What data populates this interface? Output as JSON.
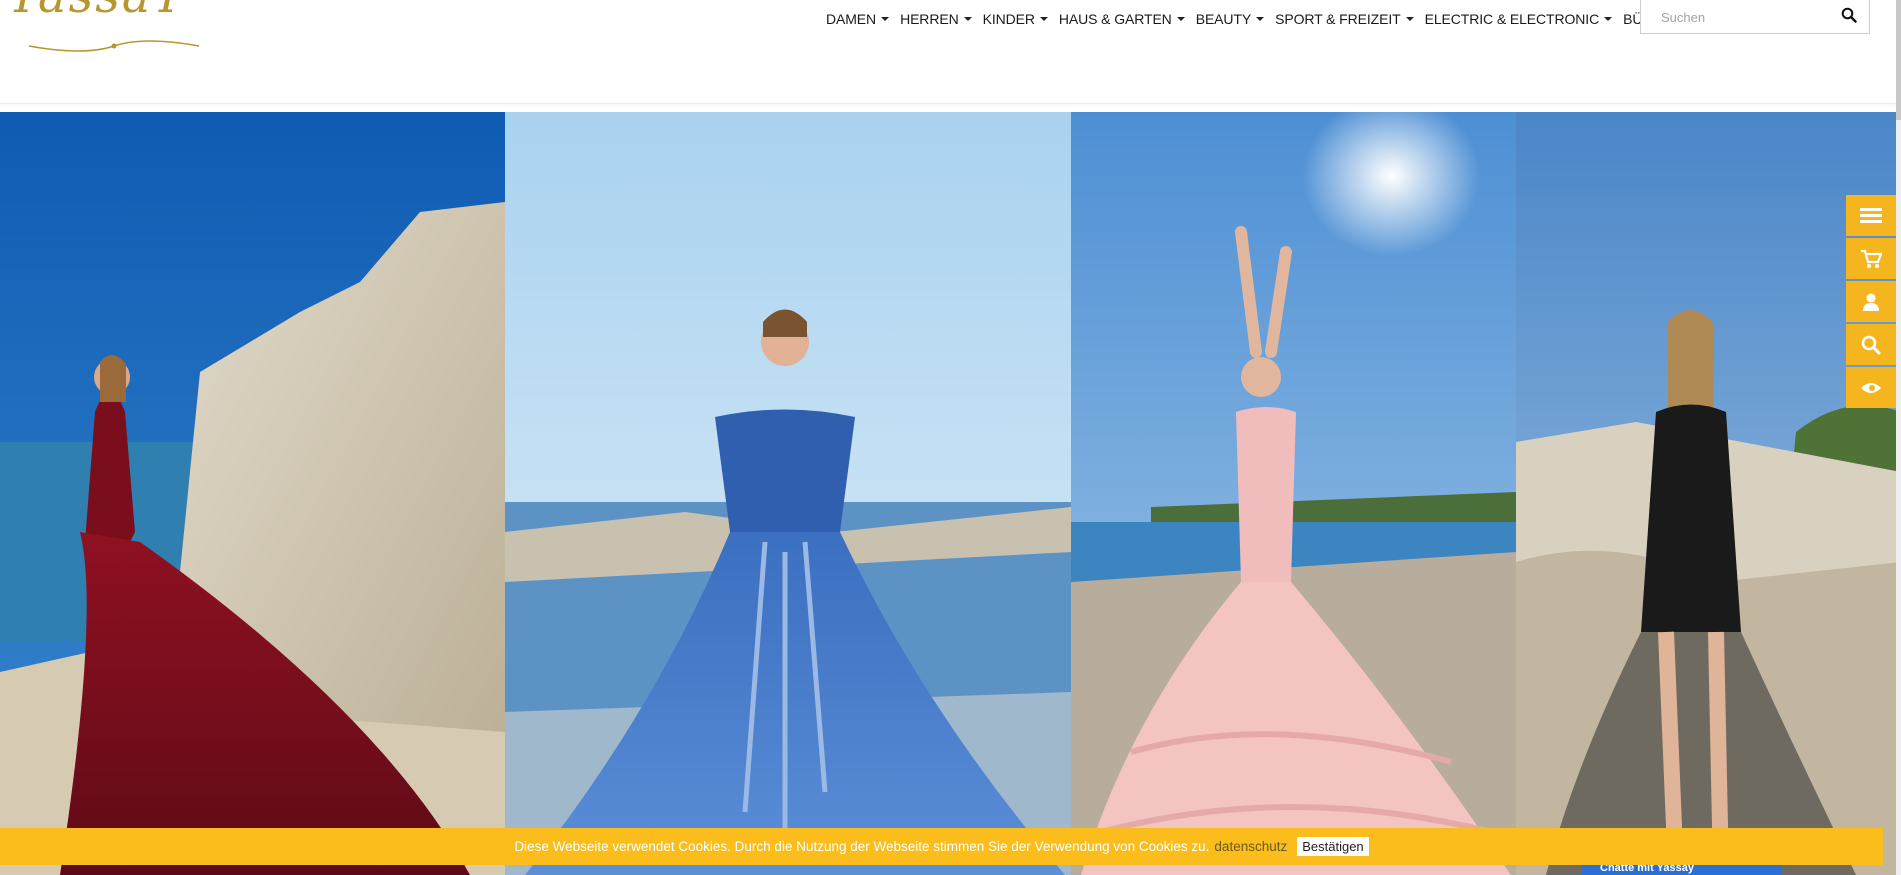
{
  "header": {
    "logo_text": "YassaY",
    "nav": [
      {
        "label": "DAMEN"
      },
      {
        "label": "HERREN"
      },
      {
        "label": "KINDER"
      },
      {
        "label": "HAUS & GARTEN"
      },
      {
        "label": "BEAUTY"
      },
      {
        "label": "SPORT & FREIZEIT"
      },
      {
        "label": "ELECTRIC & ELECTRONIC"
      },
      {
        "label": "BÜCHER"
      }
    ],
    "search": {
      "placeholder": "Suchen"
    }
  },
  "side_tools": [
    "menu-list-icon",
    "cart-icon",
    "user-icon",
    "search-icon",
    "eye-icon"
  ],
  "cookie": {
    "message": "Diese Webseite verwendet Cookies. Durch die Nutzung der Webseite stimmen Sie der Verwendung von Cookies zu.",
    "link": "datenschutz",
    "button": "Bestätigen"
  },
  "chat": {
    "label": "Chatte mit Yassay"
  },
  "colors": {
    "accent": "#f5b51e",
    "cookie_bar": "#fbbd1c",
    "logo_gold": "#b8962e"
  }
}
